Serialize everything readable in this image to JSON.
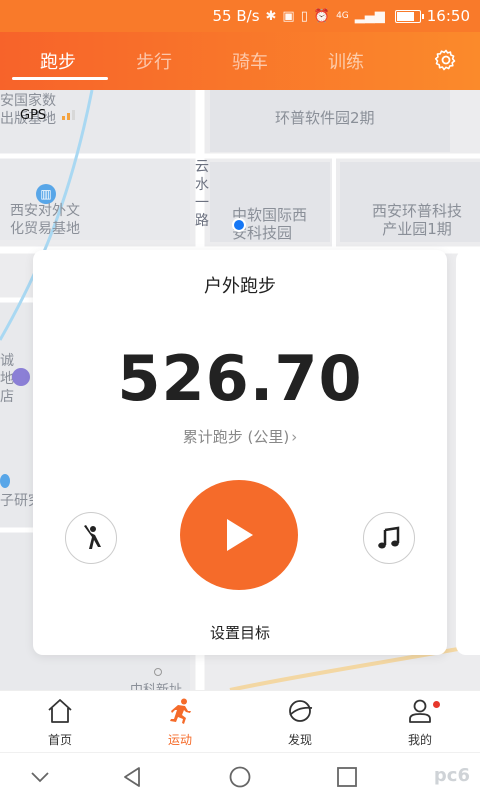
{
  "status_bar": {
    "net_speed": "55 B/s",
    "icons": [
      "bluetooth-icon",
      "nfc-icon",
      "vibrate-icon",
      "alarm-icon",
      "signal-icon",
      "battery-icon"
    ],
    "network_label": "4G",
    "battery_level": 0.7,
    "time": "16:50"
  },
  "tabs": [
    {
      "label": "跑步",
      "active": true
    },
    {
      "label": "步行",
      "active": false
    },
    {
      "label": "骑车",
      "active": false
    },
    {
      "label": "训练",
      "active": false
    }
  ],
  "settings_icon": "gear-icon",
  "map": {
    "gps_label": "GPS",
    "labels": [
      "安国家数\n出版基地",
      "环普软件园2期",
      "云\n水\n一\n路",
      "西安对外文\n化贸易基地",
      "中软国际西\n安科技园",
      "西安环普科技\n产业园1期",
      "诚\n地\n店",
      "子研究",
      "中科新址"
    ]
  },
  "card": {
    "title": "户外跑步",
    "distance": "526.70",
    "distance_label": "累计跑步 (公里)",
    "goal_label": "设置目标",
    "left_button_icon": "stretch-figure-icon",
    "center_button_icon": "play-icon",
    "right_button_icon": "music-note-icon"
  },
  "bottom_nav": [
    {
      "label": "首页",
      "icon": "home-icon",
      "active": false
    },
    {
      "label": "运动",
      "icon": "runner-icon",
      "active": true
    },
    {
      "label": "发现",
      "icon": "planet-icon",
      "active": false
    },
    {
      "label": "我的",
      "icon": "person-icon",
      "active": false,
      "badge": true
    }
  ],
  "system_nav": [
    "chevron-down-icon",
    "back-icon",
    "home-circle-icon",
    "recents-icon"
  ],
  "watermark": "pc6",
  "colors": {
    "accent": "#f56b2a",
    "header_start": "#f7632a",
    "header_end": "#fb8a2b",
    "location_dot": "#1677f5"
  }
}
